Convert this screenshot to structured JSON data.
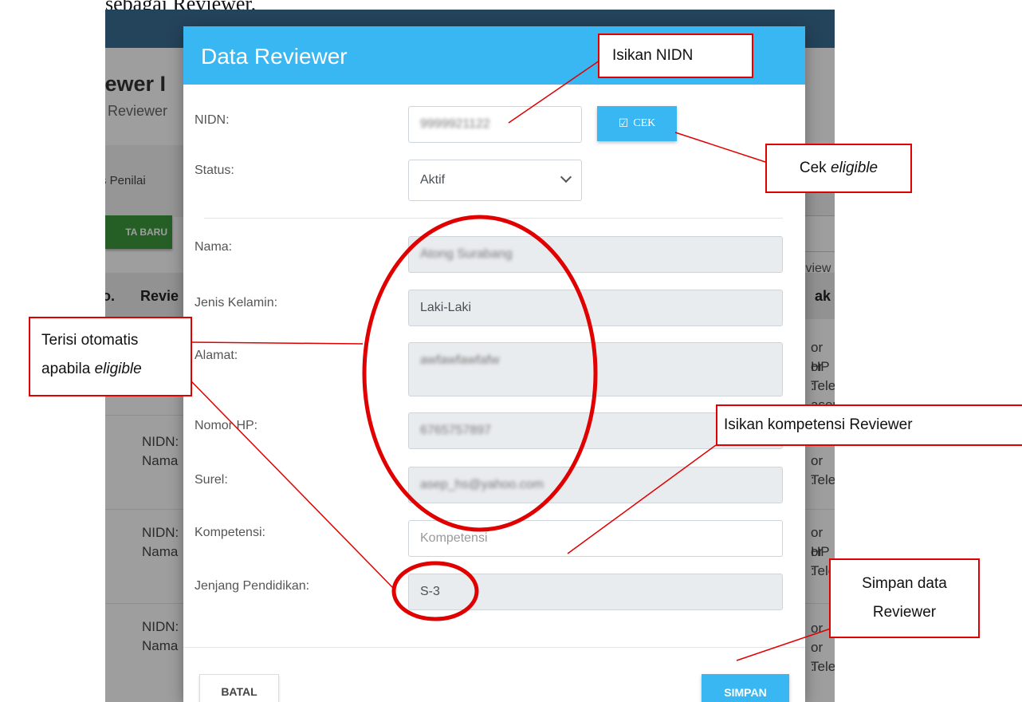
{
  "doc": {
    "heading": "sebagai Reviewer."
  },
  "background": {
    "title_fragment": "iewer I",
    "subtitle_fragment": "r Reviewer",
    "tab_fragment": "s Penilai",
    "new_button_fragment": "TA BARU",
    "search_fragment": "a Review",
    "col_no_fragment": "o.",
    "col_reviewer_fragment": "Revie",
    "col_contact_fragment": "ak",
    "rows": [
      {
        "left": [
          "",
          ""
        ],
        "right": [
          "or HP :",
          "or Tele",
          ": asep_"
        ]
      },
      {
        "left": [
          "NIDN:",
          "Nama"
        ],
        "right": [
          "",
          "or Tele",
          ":"
        ]
      },
      {
        "left": [
          "NIDN:",
          "Nama"
        ],
        "right": [
          "or HP :",
          "or Tele",
          ":"
        ]
      },
      {
        "left": [
          "NIDN:",
          "Nama"
        ],
        "right": [
          "or",
          "or Tele",
          ":"
        ]
      }
    ]
  },
  "modal": {
    "title": "Data Reviewer",
    "nidn": {
      "label": "NIDN:",
      "value": "9999921122"
    },
    "cek_label": "CEK",
    "status": {
      "label": "Status:",
      "value": "Aktif"
    },
    "nama": {
      "label": "Nama:",
      "value": "Atong Surabang"
    },
    "jenis_kelamin": {
      "label": "Jenis Kelamin:",
      "value": "Laki-Laki"
    },
    "alamat": {
      "label": "Alamat:",
      "value": "awfawfawfafw"
    },
    "nomor_hp": {
      "label": "Nomor HP:",
      "value": "6765757897"
    },
    "surel": {
      "label": "Surel:",
      "value": "asep_hs@yahoo.com"
    },
    "kompetensi": {
      "label": "Kompetensi:",
      "placeholder": "Kompetensi"
    },
    "jenjang": {
      "label": "Jenjang Pendidikan:",
      "value": "S-3"
    },
    "batal_label": "BATAL",
    "simpan_label": "SIMPAN"
  },
  "annotations": {
    "isikan_nidn": "Isikan NIDN",
    "cek_prefix": "Cek ",
    "cek_italic": "eligible",
    "terisi_line1": "Terisi otomatis",
    "terisi_line2_prefix": "apabila ",
    "terisi_line2_italic": "eligible",
    "kompetensi": "Isikan kompetensi Reviewer",
    "simpan_line1": "Simpan data",
    "simpan_line2": "Reviewer"
  },
  "colors": {
    "header": "#39b7f3",
    "annotation": "#e00000",
    "topbar": "#3a6f95"
  }
}
